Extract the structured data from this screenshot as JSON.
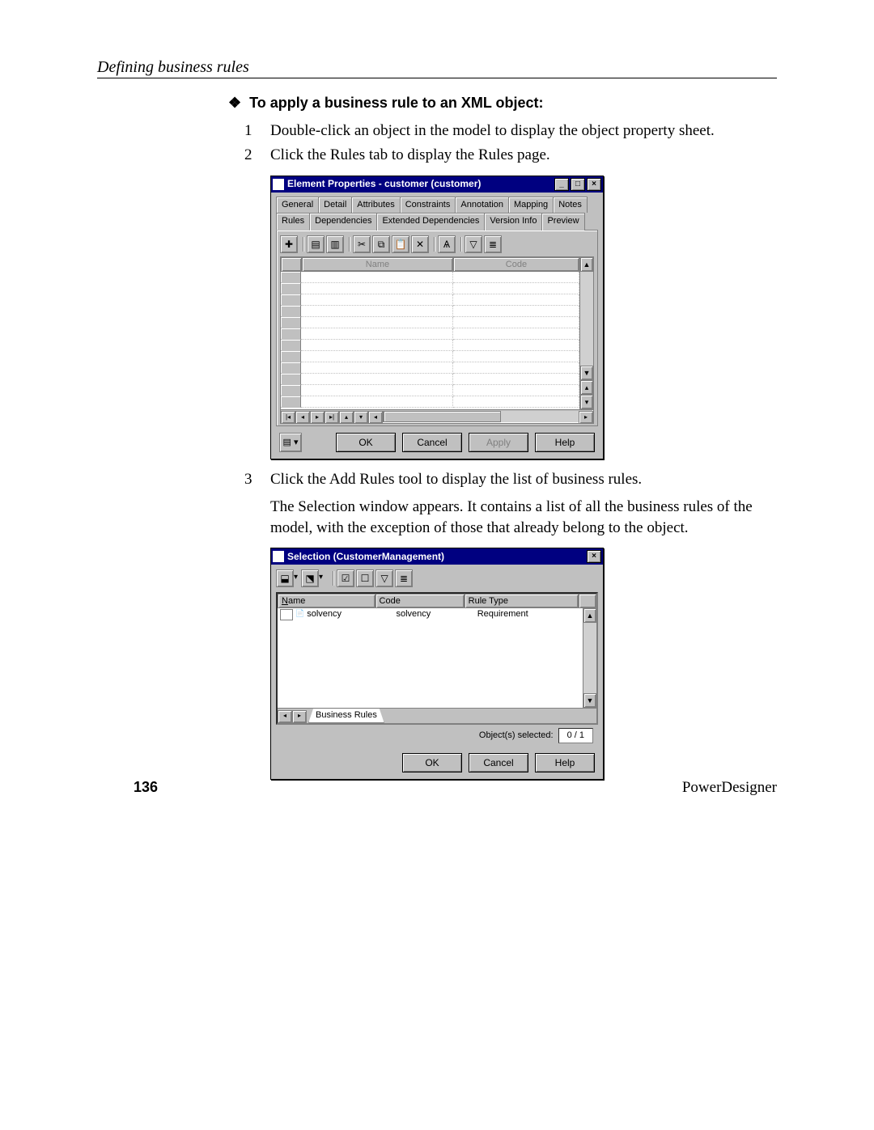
{
  "header": {
    "section": "Defining business rules"
  },
  "section_title": "To apply a business rule to an XML object:",
  "steps": {
    "s1_num": "1",
    "s1_txt": "Double-click an object in the model to display the object property sheet.",
    "s2_num": "2",
    "s2_txt": "Click the Rules tab to display the Rules page.",
    "s3_num": "3",
    "s3_txt": "Click the Add Rules tool to display the list of business rules."
  },
  "para_after_s3": "The Selection window appears. It contains a list of all the business rules of the model, with the exception of those that already belong to the object.",
  "dialog1": {
    "title": "Element Properties - customer (customer)",
    "tabs_row1": [
      "General",
      "Detail",
      "Attributes",
      "Constraints",
      "Annotation",
      "Mapping",
      "Notes"
    ],
    "tabs_row2": [
      "Rules",
      "Dependencies",
      "Extended Dependencies",
      "Version Info",
      "Preview"
    ],
    "active_tab": "Rules",
    "grid_headers": {
      "name": "Name",
      "code": "Code"
    },
    "buttons": {
      "ok": "OK",
      "cancel": "Cancel",
      "apply": "Apply",
      "help": "Help"
    }
  },
  "dialog2": {
    "title": "Selection (CustomerManagement)",
    "list_headers": {
      "name": "Name",
      "code": "Code",
      "rtype": "Rule Type"
    },
    "rows": [
      {
        "name": "solvency",
        "code": "solvency",
        "rtype": "Requirement"
      }
    ],
    "sheet_tab": "Business Rules",
    "status_label": "Object(s) selected:",
    "status_value": "0 / 1",
    "buttons": {
      "ok": "OK",
      "cancel": "Cancel",
      "help": "Help"
    }
  },
  "footer": {
    "page_number": "136",
    "product": "PowerDesigner"
  }
}
